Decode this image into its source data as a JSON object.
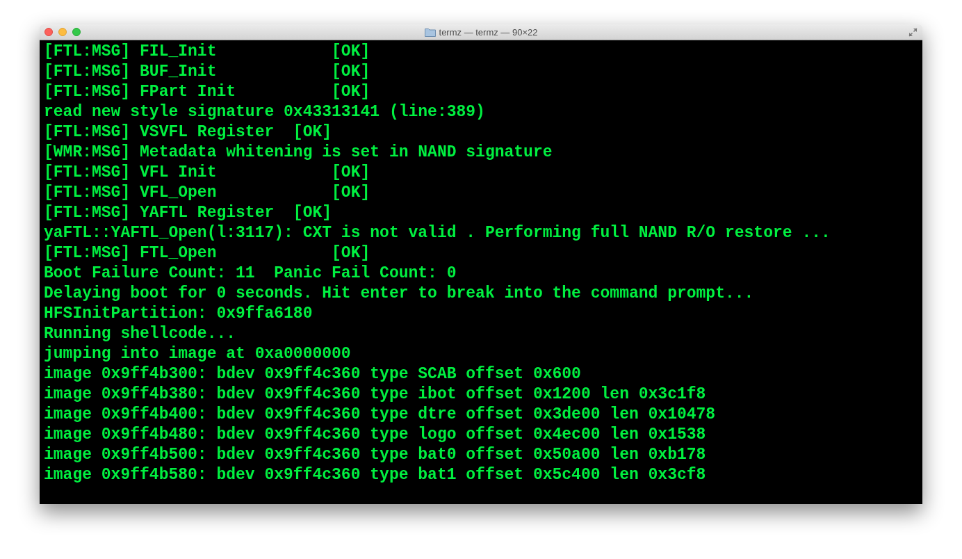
{
  "window": {
    "title": "termz — termz — 90×22"
  },
  "terminal": {
    "lines": [
      "[FTL:MSG] FIL_Init            [OK]",
      "[FTL:MSG] BUF_Init            [OK]",
      "[FTL:MSG] FPart Init          [OK]",
      "read new style signature 0x43313141 (line:389)",
      "[FTL:MSG] VSVFL Register  [OK]",
      "[WMR:MSG] Metadata whitening is set in NAND signature",
      "[FTL:MSG] VFL Init            [OK]",
      "[FTL:MSG] VFL_Open            [OK]",
      "[FTL:MSG] YAFTL Register  [OK]",
      "yaFTL::YAFTL_Open(l:3117): CXT is not valid . Performing full NAND R/O restore ...",
      "[FTL:MSG] FTL_Open            [OK]",
      "Boot Failure Count: 11  Panic Fail Count: 0",
      "Delaying boot for 0 seconds. Hit enter to break into the command prompt...",
      "HFSInitPartition: 0x9ffa6180",
      "Running shellcode...",
      "jumping into image at 0xa0000000",
      "image 0x9ff4b300: bdev 0x9ff4c360 type SCAB offset 0x600",
      "image 0x9ff4b380: bdev 0x9ff4c360 type ibot offset 0x1200 len 0x3c1f8",
      "image 0x9ff4b400: bdev 0x9ff4c360 type dtre offset 0x3de00 len 0x10478",
      "image 0x9ff4b480: bdev 0x9ff4c360 type logo offset 0x4ec00 len 0x1538",
      "image 0x9ff4b500: bdev 0x9ff4c360 type bat0 offset 0x50a00 len 0xb178",
      "image 0x9ff4b580: bdev 0x9ff4c360 type bat1 offset 0x5c400 len 0x3cf8"
    ]
  }
}
